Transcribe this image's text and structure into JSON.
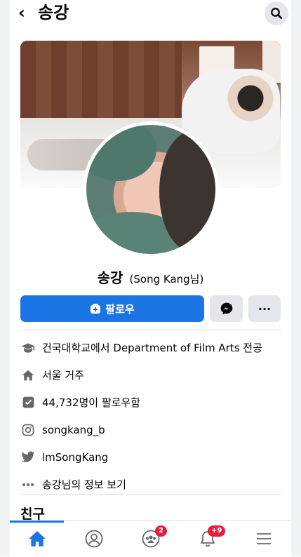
{
  "header": {
    "back_glyph": "‹",
    "title": "송강",
    "search_icon": "search-icon"
  },
  "profile": {
    "name": "송강",
    "alt_name": "(Song Kang님)",
    "follow_label": "팔로우",
    "more_label": "···"
  },
  "info": [
    {
      "icon": "graduation-cap-icon",
      "text": "건국대학교에서 Department of Film Arts 전공"
    },
    {
      "icon": "home-icon",
      "text": "서울 거주"
    },
    {
      "icon": "followers-icon",
      "text": "44,732명이 팔로우함"
    },
    {
      "icon": "instagram-icon",
      "text": "songkang_b"
    },
    {
      "icon": "twitter-icon",
      "text": "lmSongKang"
    },
    {
      "icon": "more-dots-icon",
      "text": "송강님의 정보 보기"
    }
  ],
  "friends_title": "친구",
  "nav": {
    "groups_badge": "2",
    "notifications_badge": "+9"
  },
  "colors": {
    "accent": "#1b74e4",
    "badge": "#e41e3f"
  }
}
